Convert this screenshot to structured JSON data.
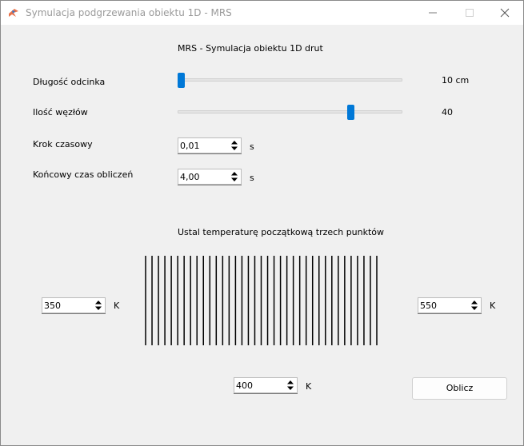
{
  "window": {
    "title": "Symulacja podgrzewania obiektu 1D - MRS",
    "controls": [
      "minimize-icon",
      "maximize-icon",
      "close-icon"
    ]
  },
  "main": {
    "heading": "MRS - Symulacja obiektu 1D drut",
    "length": {
      "label": "Długość odcinka",
      "value_text": "10 cm",
      "fraction": 0.0
    },
    "nodes": {
      "label": "Ilość węzłów",
      "value_text": "40",
      "fraction": 0.78
    },
    "timestep": {
      "label": "Krok czasowy",
      "value": "0,01",
      "unit": "s"
    },
    "endtime": {
      "label": "Końcowy czas obliczeń",
      "value": "4,00",
      "unit": "s"
    },
    "temp_heading": "Ustal temperaturę początkową trzech punktów",
    "temp_left": {
      "value": "350",
      "unit": "K"
    },
    "temp_right": {
      "value": "550",
      "unit": "K"
    },
    "temp_middle": {
      "value": "400",
      "unit": "K"
    },
    "compute_button": "Oblicz",
    "wire_line_count": 37
  },
  "colors": {
    "accent": "#0078d7",
    "background": "#f0f0f0"
  }
}
